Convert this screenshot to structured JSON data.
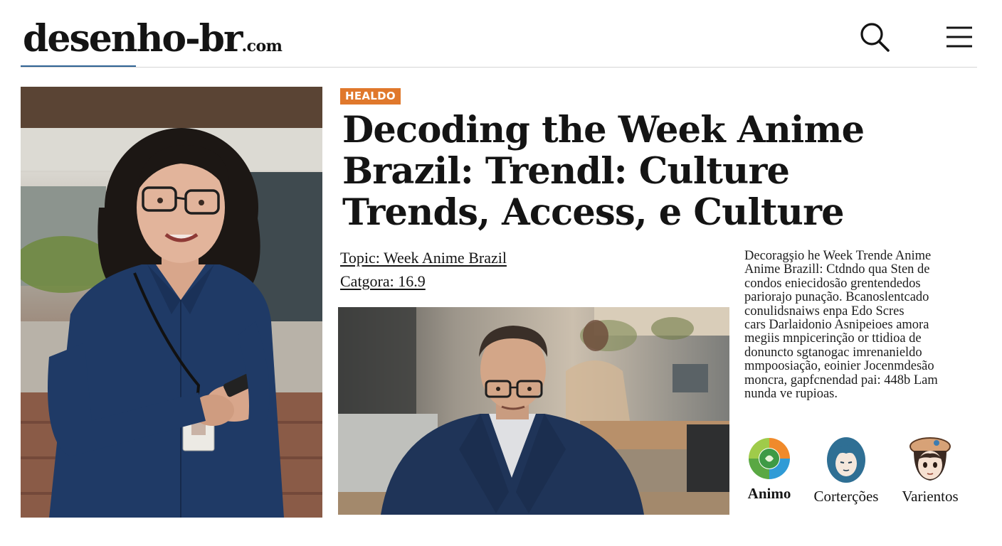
{
  "site": {
    "logo_main": "desenho-br",
    "logo_tld": ".com"
  },
  "header": {
    "search_icon": "search-icon",
    "menu_icon": "hamburger-menu-icon"
  },
  "article": {
    "badge": "HEALDO",
    "badge_color": "#e0782c",
    "headline_lines": [
      "Decoding the Week Anime",
      "Brazil: Trendl: Culture",
      "Trends, Access, e Culture"
    ],
    "topic": "Topic:  Week Anime Brazil",
    "category": "Catgora: 16.9",
    "body_lines": [
      "Decoragşio he Week Trende Anime",
      "Anime Brazill: Ctdndo qua Sten de",
      "condos eniecidosão grentendedos",
      "pariorajo punação. Bcanoslentcado",
      "conulidsnaiws enpa Edo Scres",
      "cars Darlaidonio Asnipeioes amora",
      "megiis mnpicerinção or ttidioa de",
      "donuncto sgtanogac imrenanieldo",
      "mmpoosiação, eoinier Jocenmdesão",
      "moncra, gapfcnendad pai: 448b Lam",
      "nunda ve rupioas."
    ]
  },
  "tags": [
    {
      "label": "Animo",
      "icon": "anime-colorful-circle-icon"
    },
    {
      "label": "Corterções",
      "icon": "anime-boy-avatar-icon"
    },
    {
      "label": "Varientos",
      "icon": "anime-girl-beret-icon"
    }
  ],
  "colors": {
    "accent_blue": "#2f6394",
    "badge_orange": "#e0782c"
  }
}
